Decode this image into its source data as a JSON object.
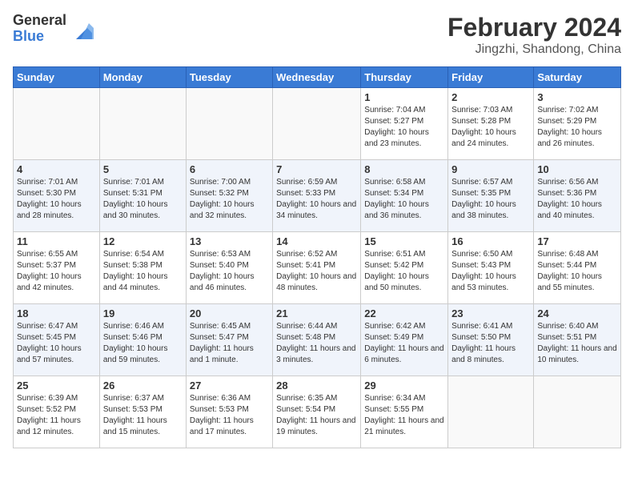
{
  "header": {
    "logo_general": "General",
    "logo_blue": "Blue",
    "month_title": "February 2024",
    "location": "Jingzhi, Shandong, China"
  },
  "days_of_week": [
    "Sunday",
    "Monday",
    "Tuesday",
    "Wednesday",
    "Thursday",
    "Friday",
    "Saturday"
  ],
  "weeks": [
    [
      {
        "day": "",
        "empty": true
      },
      {
        "day": "",
        "empty": true
      },
      {
        "day": "",
        "empty": true
      },
      {
        "day": "",
        "empty": true
      },
      {
        "day": "1",
        "sunrise": "7:04 AM",
        "sunset": "5:27 PM",
        "daylight": "10 hours and 23 minutes."
      },
      {
        "day": "2",
        "sunrise": "7:03 AM",
        "sunset": "5:28 PM",
        "daylight": "10 hours and 24 minutes."
      },
      {
        "day": "3",
        "sunrise": "7:02 AM",
        "sunset": "5:29 PM",
        "daylight": "10 hours and 26 minutes."
      }
    ],
    [
      {
        "day": "4",
        "sunrise": "7:01 AM",
        "sunset": "5:30 PM",
        "daylight": "10 hours and 28 minutes."
      },
      {
        "day": "5",
        "sunrise": "7:01 AM",
        "sunset": "5:31 PM",
        "daylight": "10 hours and 30 minutes."
      },
      {
        "day": "6",
        "sunrise": "7:00 AM",
        "sunset": "5:32 PM",
        "daylight": "10 hours and 32 minutes."
      },
      {
        "day": "7",
        "sunrise": "6:59 AM",
        "sunset": "5:33 PM",
        "daylight": "10 hours and 34 minutes."
      },
      {
        "day": "8",
        "sunrise": "6:58 AM",
        "sunset": "5:34 PM",
        "daylight": "10 hours and 36 minutes."
      },
      {
        "day": "9",
        "sunrise": "6:57 AM",
        "sunset": "5:35 PM",
        "daylight": "10 hours and 38 minutes."
      },
      {
        "day": "10",
        "sunrise": "6:56 AM",
        "sunset": "5:36 PM",
        "daylight": "10 hours and 40 minutes."
      }
    ],
    [
      {
        "day": "11",
        "sunrise": "6:55 AM",
        "sunset": "5:37 PM",
        "daylight": "10 hours and 42 minutes."
      },
      {
        "day": "12",
        "sunrise": "6:54 AM",
        "sunset": "5:38 PM",
        "daylight": "10 hours and 44 minutes."
      },
      {
        "day": "13",
        "sunrise": "6:53 AM",
        "sunset": "5:40 PM",
        "daylight": "10 hours and 46 minutes."
      },
      {
        "day": "14",
        "sunrise": "6:52 AM",
        "sunset": "5:41 PM",
        "daylight": "10 hours and 48 minutes."
      },
      {
        "day": "15",
        "sunrise": "6:51 AM",
        "sunset": "5:42 PM",
        "daylight": "10 hours and 50 minutes."
      },
      {
        "day": "16",
        "sunrise": "6:50 AM",
        "sunset": "5:43 PM",
        "daylight": "10 hours and 53 minutes."
      },
      {
        "day": "17",
        "sunrise": "6:48 AM",
        "sunset": "5:44 PM",
        "daylight": "10 hours and 55 minutes."
      }
    ],
    [
      {
        "day": "18",
        "sunrise": "6:47 AM",
        "sunset": "5:45 PM",
        "daylight": "10 hours and 57 minutes."
      },
      {
        "day": "19",
        "sunrise": "6:46 AM",
        "sunset": "5:46 PM",
        "daylight": "10 hours and 59 minutes."
      },
      {
        "day": "20",
        "sunrise": "6:45 AM",
        "sunset": "5:47 PM",
        "daylight": "11 hours and 1 minute."
      },
      {
        "day": "21",
        "sunrise": "6:44 AM",
        "sunset": "5:48 PM",
        "daylight": "11 hours and 3 minutes."
      },
      {
        "day": "22",
        "sunrise": "6:42 AM",
        "sunset": "5:49 PM",
        "daylight": "11 hours and 6 minutes."
      },
      {
        "day": "23",
        "sunrise": "6:41 AM",
        "sunset": "5:50 PM",
        "daylight": "11 hours and 8 minutes."
      },
      {
        "day": "24",
        "sunrise": "6:40 AM",
        "sunset": "5:51 PM",
        "daylight": "11 hours and 10 minutes."
      }
    ],
    [
      {
        "day": "25",
        "sunrise": "6:39 AM",
        "sunset": "5:52 PM",
        "daylight": "11 hours and 12 minutes."
      },
      {
        "day": "26",
        "sunrise": "6:37 AM",
        "sunset": "5:53 PM",
        "daylight": "11 hours and 15 minutes."
      },
      {
        "day": "27",
        "sunrise": "6:36 AM",
        "sunset": "5:53 PM",
        "daylight": "11 hours and 17 minutes."
      },
      {
        "day": "28",
        "sunrise": "6:35 AM",
        "sunset": "5:54 PM",
        "daylight": "11 hours and 19 minutes."
      },
      {
        "day": "29",
        "sunrise": "6:34 AM",
        "sunset": "5:55 PM",
        "daylight": "11 hours and 21 minutes."
      },
      {
        "day": "",
        "empty": true
      },
      {
        "day": "",
        "empty": true
      }
    ]
  ]
}
